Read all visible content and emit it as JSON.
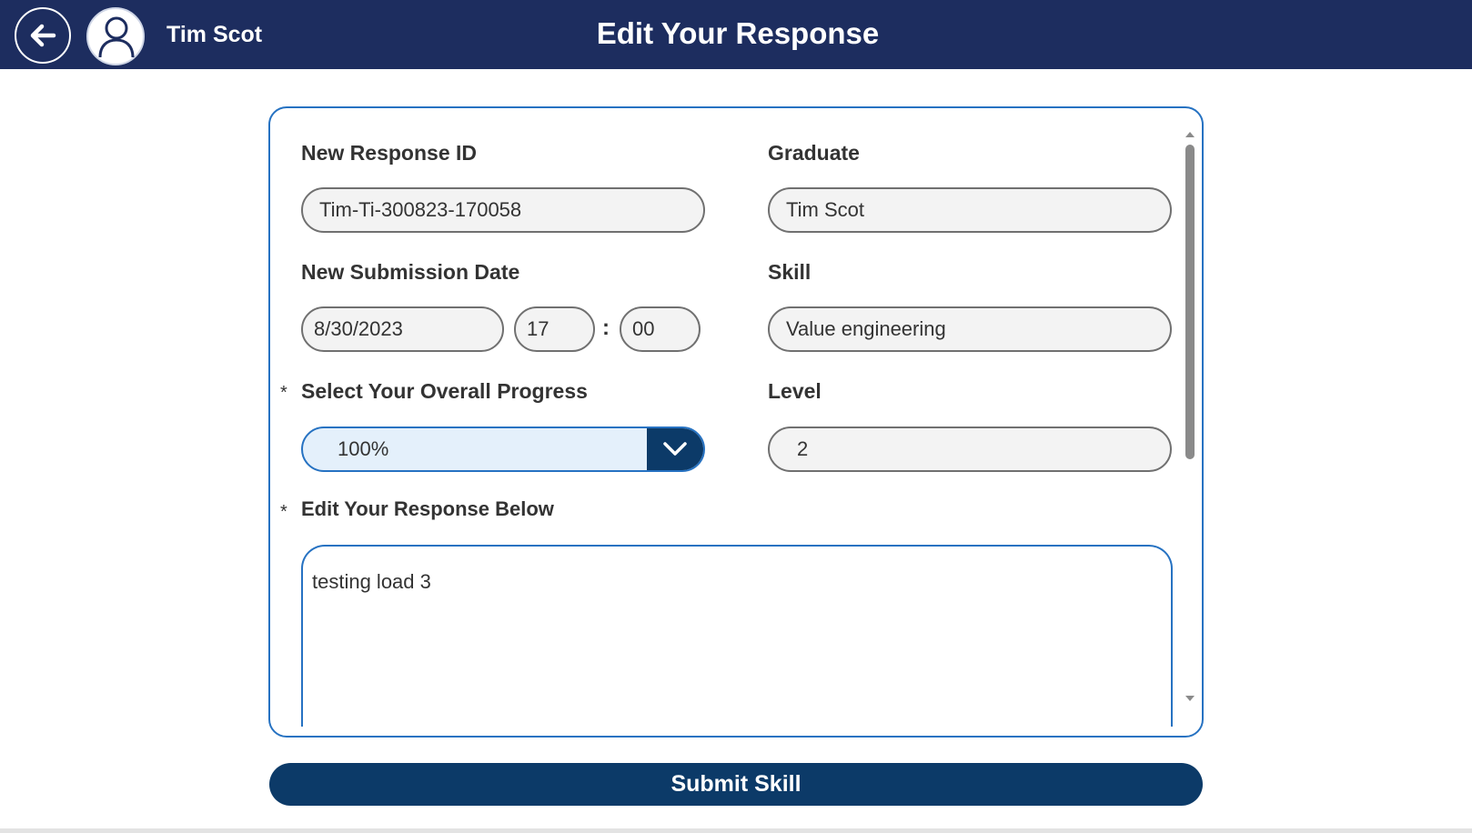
{
  "header": {
    "user_name": "Tim Scot",
    "title": "Edit Your Response"
  },
  "form": {
    "response_id": {
      "label": "New Response ID",
      "value": "Tim-Ti-300823-170058"
    },
    "graduate": {
      "label": "Graduate",
      "value": "Tim Scot"
    },
    "submission_date": {
      "label": "New Submission Date",
      "date": "8/30/2023",
      "hour": "17",
      "separator": ":",
      "minute": "00"
    },
    "skill": {
      "label": "Skill",
      "value": "Value engineering"
    },
    "progress": {
      "label": "Select Your Overall Progress",
      "required_marker": "*",
      "selected": "100%"
    },
    "level": {
      "label": "Level",
      "value": "2"
    },
    "response": {
      "label": "Edit Your Response Below",
      "required_marker": "*",
      "value": "testing load 3"
    }
  },
  "actions": {
    "submit_label": "Submit Skill"
  },
  "colors": {
    "header_bg": "#1d2d5f",
    "accent": "#2672c2",
    "button_bg": "#0c3a68"
  }
}
